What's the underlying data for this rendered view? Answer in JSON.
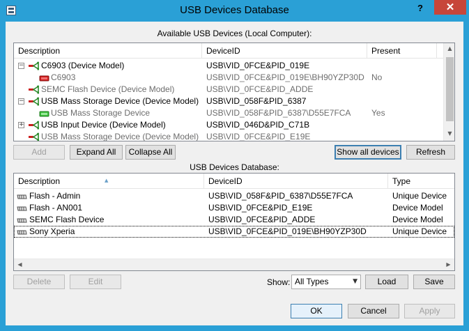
{
  "window": {
    "title": "USB Devices Database",
    "help_glyph": "?",
    "close_glyph": "✕"
  },
  "available": {
    "label": "Available USB Devices (Local Computer):",
    "columns": [
      "Description",
      "DeviceID",
      "Present"
    ],
    "rows": [
      {
        "description": "C6903 (Device Model)",
        "device_id": "USB\\VID_0FCE&PID_019E",
        "present": "",
        "expander": "−",
        "icon": "usb-green",
        "gray": false,
        "level": 0
      },
      {
        "description": "C6903",
        "device_id": "USB\\VID_0FCE&PID_019E\\BH90YZP30D",
        "present": "No",
        "expander": "",
        "icon": "device-red",
        "gray": true,
        "level": 1
      },
      {
        "description": "SEMC Flash Device (Device Model)",
        "device_id": "USB\\VID_0FCE&PID_ADDE",
        "present": "",
        "expander": "",
        "icon": "usb-green",
        "gray": true,
        "level": 0
      },
      {
        "description": "USB Mass Storage Device (Device Model)",
        "device_id": "USB\\VID_058F&PID_6387",
        "present": "",
        "expander": "−",
        "icon": "usb-green",
        "gray": false,
        "level": 0
      },
      {
        "description": "USB Mass Storage Device",
        "device_id": "USB\\VID_058F&PID_6387\\D55E7FCA",
        "present": "Yes",
        "expander": "",
        "icon": "device-green",
        "gray": true,
        "level": 1
      },
      {
        "description": "USB Input Device (Device Model)",
        "device_id": "USB\\VID_046D&PID_C71B",
        "present": "",
        "expander": "+",
        "icon": "usb-green",
        "gray": false,
        "level": 0
      },
      {
        "description": "USB Mass Storage Device (Device Model)",
        "device_id": "USB\\VID_0FCE&PID_E19E",
        "present": "",
        "expander": "",
        "icon": "usb-green",
        "gray": true,
        "level": 0
      }
    ],
    "buttons": {
      "add": "Add",
      "expand_all": "Expand All",
      "collapse_all": "Collapse All",
      "show_all": "Show all devices",
      "refresh": "Refresh"
    }
  },
  "database": {
    "label": "USB Devices Database:",
    "columns": [
      "Description",
      "DeviceID",
      "Type"
    ],
    "rows": [
      {
        "description": "Flash - Admin",
        "device_id": "USB\\VID_058F&PID_6387\\D55E7FCA",
        "type": "Unique Device"
      },
      {
        "description": "Flash - AN001",
        "device_id": "USB\\VID_0FCE&PID_E19E",
        "type": "Device Model"
      },
      {
        "description": "SEMC Flash Device",
        "device_id": "USB\\VID_0FCE&PID_ADDE",
        "type": "Device Model"
      },
      {
        "description": "Sony Xperia",
        "device_id": "USB\\VID_0FCE&PID_019E\\BH90YZP30D",
        "type": "Unique Device"
      }
    ],
    "buttons": {
      "delete": "Delete",
      "edit": "Edit",
      "load": "Load",
      "save": "Save"
    },
    "show_label": "Show:",
    "show_selected": "All Types"
  },
  "footer": {
    "ok": "OK",
    "cancel": "Cancel",
    "apply": "Apply"
  }
}
